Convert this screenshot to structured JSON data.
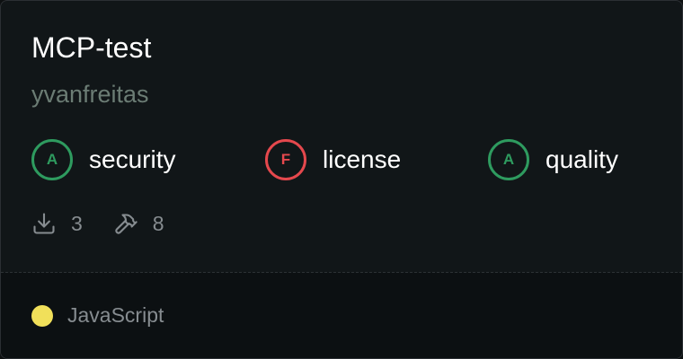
{
  "card": {
    "title": "MCP-test",
    "owner": "yvanfreitas"
  },
  "grades": [
    {
      "letter": "A",
      "label": "security",
      "status": "pass"
    },
    {
      "letter": "F",
      "label": "license",
      "status": "fail"
    },
    {
      "letter": "A",
      "label": "quality",
      "status": "pass"
    }
  ],
  "stats": {
    "downloads": "3",
    "tools": "8"
  },
  "language": {
    "name": "JavaScript",
    "color": "#f1e05a"
  },
  "colors": {
    "pass": "#2e9b5f",
    "fail": "#e5484d"
  },
  "icons": {
    "downloads": "download-icon",
    "tools": "hammer-icon"
  }
}
